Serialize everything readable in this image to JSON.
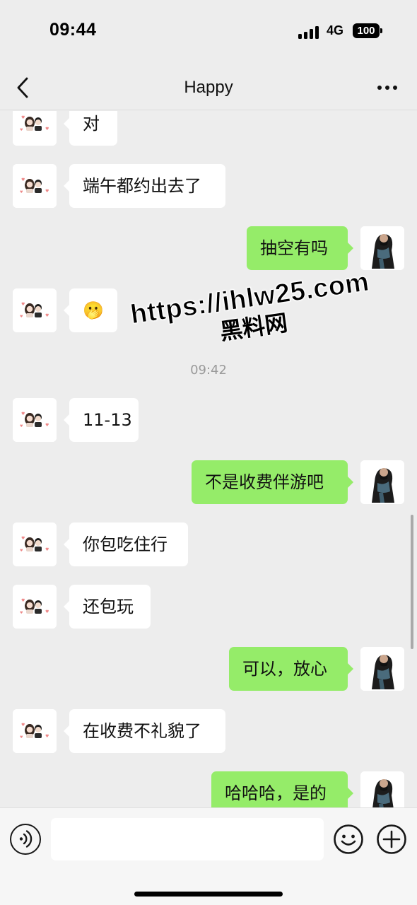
{
  "status_bar": {
    "time": "09:44",
    "network": "4G",
    "battery": "100",
    "signal_bars": 4
  },
  "nav": {
    "title": "Happy",
    "back_icon": "chevron-left-icon",
    "more_icon": "more-dots-icon"
  },
  "messages": [
    {
      "side": "left",
      "text": "对"
    },
    {
      "side": "left",
      "text": "端午都约出去了"
    },
    {
      "side": "right",
      "text": "抽空有吗"
    },
    {
      "side": "left",
      "text": "🫢"
    },
    {
      "side": "time",
      "text": "09:42"
    },
    {
      "side": "left",
      "text": "11-13"
    },
    {
      "side": "right",
      "text": "不是收费伴游吧"
    },
    {
      "side": "left",
      "text": "你包吃住行"
    },
    {
      "side": "left",
      "text": "还包玩"
    },
    {
      "side": "right",
      "text": "可以，放心"
    },
    {
      "side": "left",
      "text": "在收费不礼貌了"
    },
    {
      "side": "right",
      "text": "哈哈哈，是的"
    }
  ],
  "watermark": {
    "url": "https://ihlw25.com",
    "name": "黑料网"
  },
  "input_bar": {
    "voice_icon": "voice-icon",
    "emoji_icon": "emoji-icon",
    "plus_icon": "plus-icon",
    "text_value": ""
  },
  "colors": {
    "background": "#ededed",
    "bubble_self": "#95ec69",
    "bubble_other": "#ffffff"
  }
}
